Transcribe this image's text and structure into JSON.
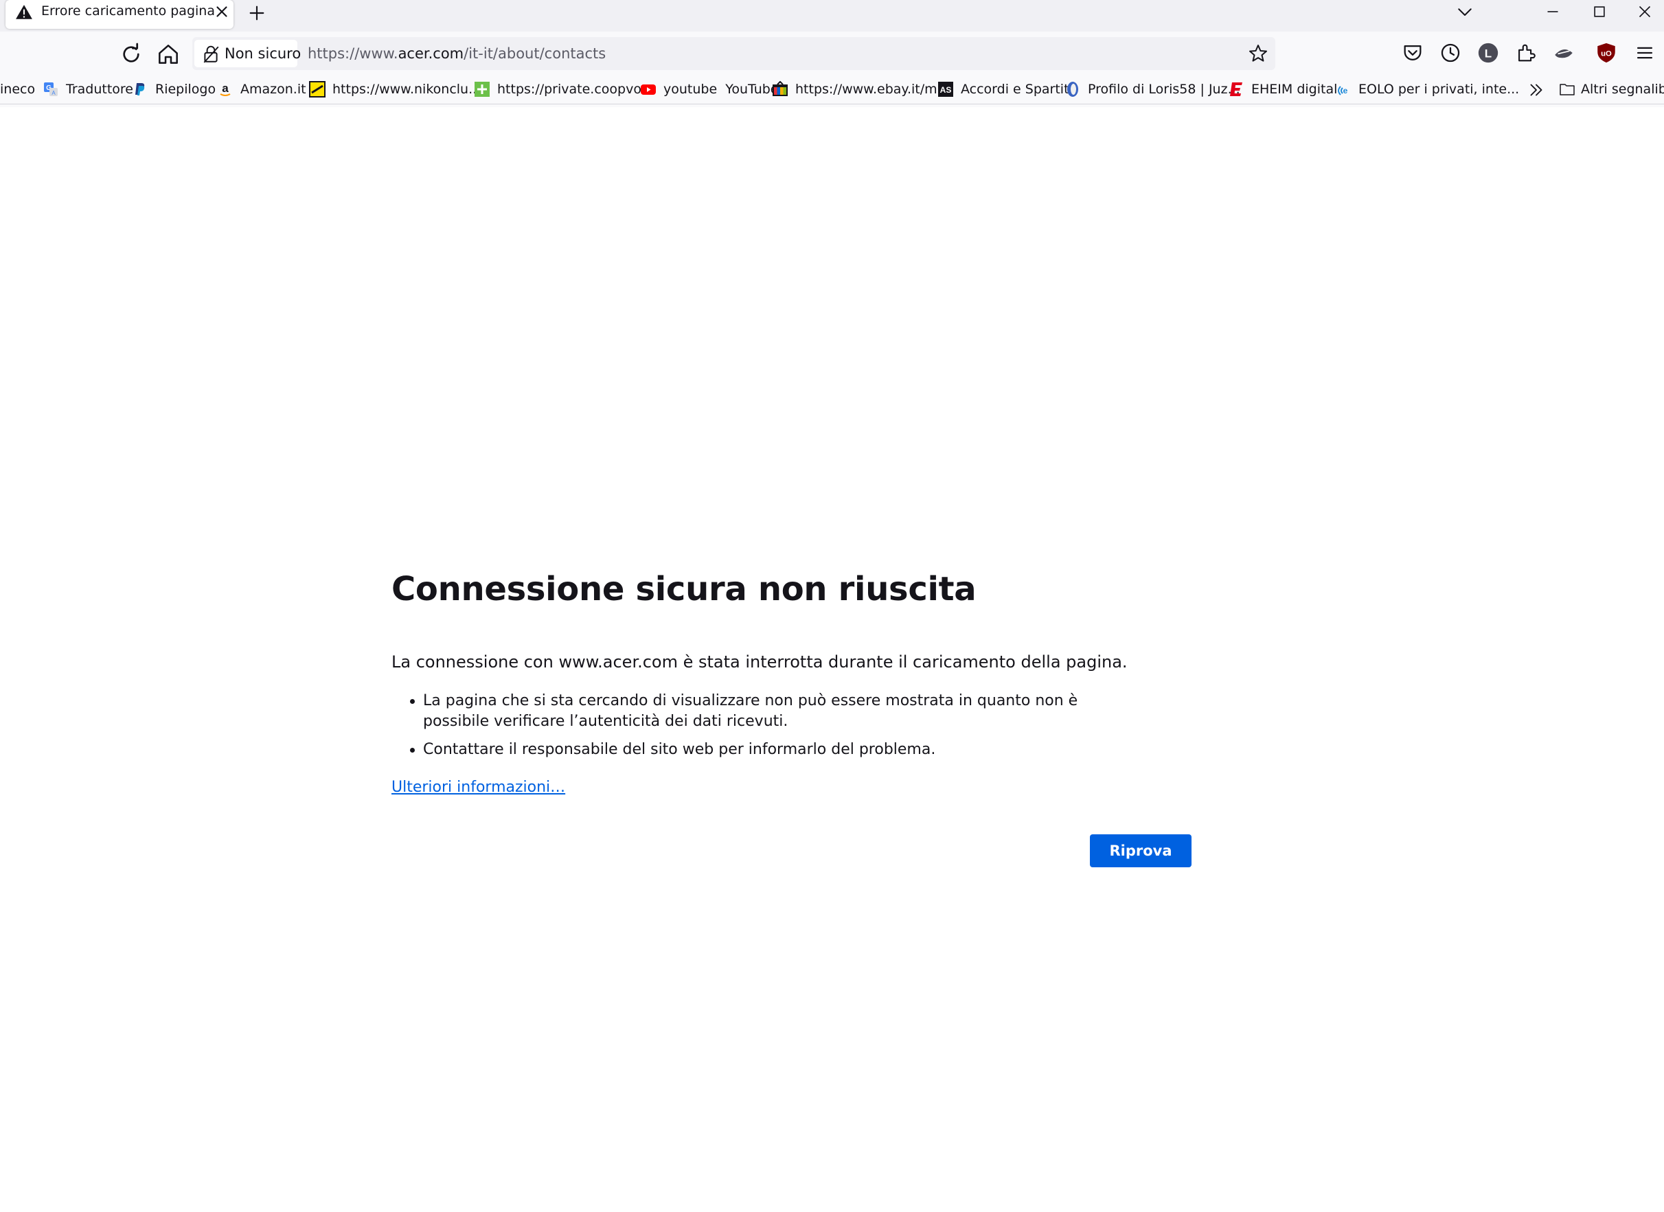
{
  "tab": {
    "title": "Errore caricamento pagina",
    "icon": "warning-icon"
  },
  "urlbar": {
    "identity_label": "Non sicuro",
    "url_prefix": "https://www.",
    "url_host": "acer.com",
    "url_path": "/it-it/about/contacts"
  },
  "bookmarks": [
    {
      "label": "ineco",
      "icon": "none"
    },
    {
      "label": "Traduttore",
      "icon": "google-translate-icon"
    },
    {
      "label": "Riepilogo",
      "icon": "paypal-icon"
    },
    {
      "label": "Amazon.it",
      "icon": "amazon-icon"
    },
    {
      "label": "https://www.nikonclu...",
      "icon": "nikon-icon"
    },
    {
      "label": "https://private.coopvo...",
      "icon": "coop-icon"
    },
    {
      "label": "youtube  YouTube",
      "icon": "youtube-icon"
    },
    {
      "label": "https://www.ebay.it/m...",
      "icon": "ebay-icon"
    },
    {
      "label": "Accordi e Spartiti",
      "icon": "accordi-icon"
    },
    {
      "label": "Profilo di Loris58 | Juz...",
      "icon": "juzaphoto-icon"
    },
    {
      "label": "EHEIM digital",
      "icon": "eheim-icon"
    },
    {
      "label": "EOLO per i privati, inte...",
      "icon": "eolo-icon"
    }
  ],
  "bookmarks_other": "Altri segnalibri",
  "error": {
    "title": "Connessione sicura non riuscita",
    "intro": "La connessione con www.acer.com è stata interrotta durante il caricamento della pagina.",
    "bullets": [
      "La pagina che si sta cercando di visualizzare non può essere mostrata in quanto non è possibile verificare l’autenticità dei dati ricevuti.",
      "Contattare il responsabile del sito web per informarlo del problema."
    ],
    "learn_more": "Ulteriori informazioni…",
    "retry": "Riprova"
  },
  "colors": {
    "accent": "#0061e0",
    "ublock_red": "#800000",
    "youtube_red": "#ff0000"
  }
}
